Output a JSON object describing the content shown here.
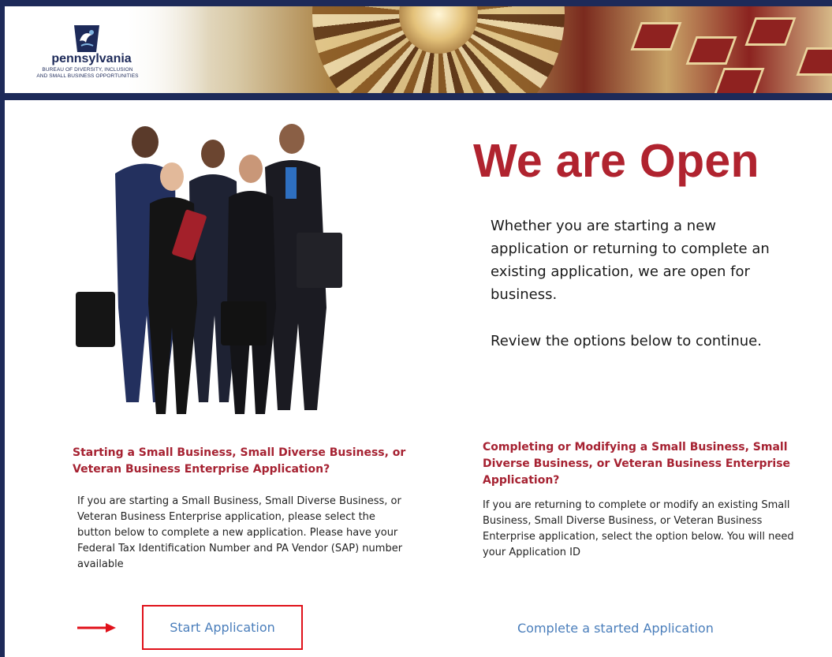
{
  "banner": {
    "logo_title": "pennsylvania",
    "logo_subtitle_line1": "BUREAU OF DIVERSITY, INCLUSION",
    "logo_subtitle_line2": "AND SMALL BUSINESS OPPORTUNITIES",
    "logo_icon": "keystone-icon"
  },
  "hero": {
    "headline": "We are Open",
    "intro": "Whether you are starting a new application or returning to complete an existing application, we are open for business.",
    "review": "Review the options below to continue.",
    "photo_alt": "business-team-photo"
  },
  "start_section": {
    "heading": "Starting a Small Business, Small Diverse Business, or Veteran Business Enterprise Application?",
    "body": "If you are starting a Small Business, Small Diverse Business, or Veteran Business Enterprise application, please select the button below to complete a new application. Please have your Federal Tax Identification Number and PA Vendor (SAP) number available",
    "link_label": "Start Application"
  },
  "complete_section": {
    "heading": "Completing or Modifying a Small Business, Small Diverse Business, or Veteran Business Enterprise Application?",
    "body": "If you are returning to complete or modify an existing Small Business, Small Diverse Business, or Veteran Business Enterprise application, select the option below. You will need your Application ID",
    "link_label": "Complete a started Application"
  },
  "colors": {
    "brand_navy": "#1d2a59",
    "headline_red": "#b0232f",
    "heading_red": "#a62232",
    "link_blue": "#4a7ebb",
    "highlight_red": "#e0111a"
  }
}
